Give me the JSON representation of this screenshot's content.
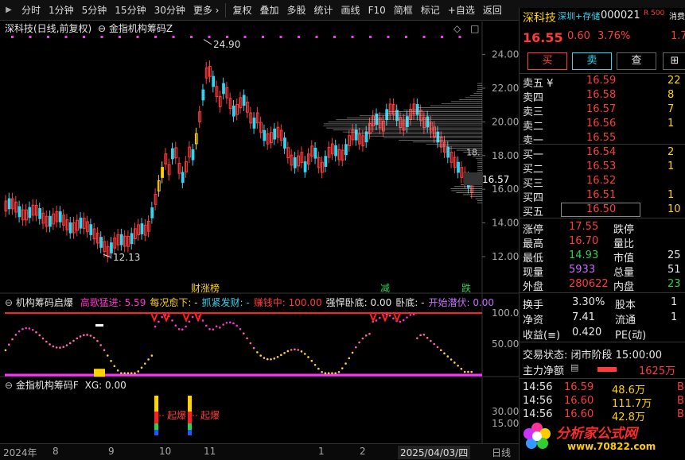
{
  "toolbar": {
    "periods": [
      "分时",
      "1分钟",
      "5分钟",
      "15分钟",
      "30分钟",
      "更多 ›"
    ],
    "tools": [
      "复权",
      "叠加",
      "多股",
      "统计",
      "画线",
      "F10",
      "简框",
      "标记",
      "+自选",
      "返回"
    ]
  },
  "main_chart": {
    "header": "深科技(日线,前复权)",
    "indicator": "金指机构筹码Z",
    "high_label": "24.90",
    "low_label": "12.13",
    "current_label": "16.57",
    "cursor_label": "18.",
    "y_ticks": [
      "24.00",
      "22.00",
      "20.00",
      "18.00",
      "16.00",
      "14.00",
      "12.00"
    ],
    "signal_labels": [
      "财涨榜",
      "减",
      "跌"
    ],
    "colors": {
      "up": "#ff3b3b",
      "down": "#2ed6f2",
      "signal": "#ffd400",
      "dots": "#ff33ff"
    }
  },
  "panel2": {
    "title": "机构筹码启爆",
    "items": [
      {
        "label": "高歌猛进:",
        "value": "5.59",
        "color": "#ff33cc"
      },
      {
        "label": "每况愈下:",
        "value": "-",
        "color": "#ffd400"
      },
      {
        "label": "抓紧发财:",
        "value": "-",
        "color": "#2ed6f2"
      },
      {
        "label": "赚钱中:",
        "value": "100.00",
        "color": "#ff3b3b"
      },
      {
        "label": "强悍卧底:",
        "value": "0.00",
        "color": "#e6e6e6"
      },
      {
        "label": "卧底:",
        "value": "-",
        "color": "#e6e6e6"
      },
      {
        "label": "开始潜伏:",
        "value": "0.00",
        "color": "#c86bff"
      }
    ],
    "y_ticks": [
      "100.00",
      "50.00"
    ]
  },
  "panel3": {
    "title": "金指机构筹码F",
    "xg": "XG: 0.00",
    "y_ticks": [
      "30.00",
      "15.00"
    ],
    "labels": [
      "起爆",
      "起爆"
    ]
  },
  "bottom_axis": {
    "year": "2024年",
    "months": [
      "8",
      "9",
      "10",
      "11",
      "1",
      "2"
    ],
    "date_box": "2025/04/03/四",
    "tab": "日线"
  },
  "quote": {
    "name": "深科技",
    "tag": "深圳+存储",
    "code": "000021",
    "badge": "R 500",
    "badge_tail": "消费",
    "price": "16.55",
    "change": "0.60",
    "pct": "3.76%",
    "tail_value": "1.7",
    "buttons": [
      "买",
      "卖",
      "查"
    ],
    "asks": [
      {
        "label": "卖五 ¥",
        "price": "16.59",
        "vol": "22"
      },
      {
        "label": "卖四",
        "price": "16.58",
        "vol": "8"
      },
      {
        "label": "卖三",
        "price": "16.57",
        "vol": "7"
      },
      {
        "label": "卖二",
        "price": "16.56",
        "vol": "1"
      },
      {
        "label": "卖一",
        "price": "16.55",
        "vol": ""
      }
    ],
    "bids": [
      {
        "label": "买一",
        "price": "16.54",
        "vol": "2"
      },
      {
        "label": "买二",
        "price": "16.53",
        "vol": "1"
      },
      {
        "label": "买三",
        "price": "16.52",
        "vol": ""
      },
      {
        "label": "买四",
        "price": "16.51",
        "vol": "1"
      },
      {
        "label": "买五",
        "price": "16.50",
        "vol": "10"
      }
    ],
    "stats": [
      {
        "l1": "涨停",
        "v1": "17.55",
        "c1": "red",
        "l2": "跌停",
        "v2": ""
      },
      {
        "l1": "最高",
        "v1": "16.70",
        "c1": "red",
        "l2": "量比",
        "v2": ""
      },
      {
        "l1": "最低",
        "v1": "14.93",
        "c1": "green",
        "l2": "市值",
        "v2": "25"
      },
      {
        "l1": "现量",
        "v1": "5933",
        "c1": "purple",
        "l2": "总量",
        "v2": "51"
      },
      {
        "l1": "外盘",
        "v1": "280622",
        "c1": "red",
        "l2": "内盘",
        "v2": "23"
      }
    ],
    "stats2": [
      {
        "l1": "换手",
        "v1": "3.30%",
        "l2": "股本",
        "v2": "1"
      },
      {
        "l1": "净资",
        "v1": "7.41",
        "l2": "流通",
        "v2": "1"
      },
      {
        "l1": "收益(≡)",
        "v1": "0.420",
        "l2": "PE(动)",
        "v2": ""
      }
    ],
    "trade_status": "交易状态: 闭市阶段 15:00:00",
    "net_label": "主力净额",
    "net_value": "1625万",
    "ticks": [
      {
        "time": "14:56",
        "price": "16.59",
        "vol": "48.6万",
        "flag": "B"
      },
      {
        "time": "14:56",
        "price": "16.60",
        "vol": "111.7万",
        "flag": "B"
      },
      {
        "time": "14:56",
        "price": "16.60",
        "vol": "42.8万",
        "flag": "B"
      }
    ],
    "watermark": "分析家公式网",
    "watermark_url": "www.70822.com"
  }
}
